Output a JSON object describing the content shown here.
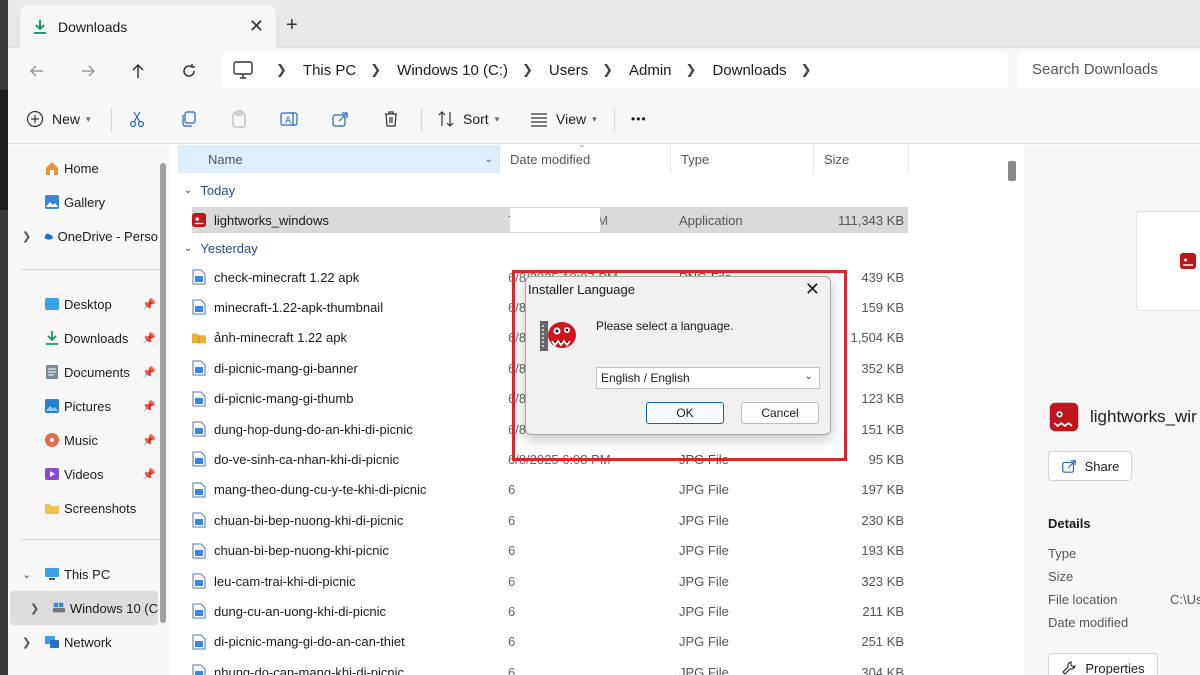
{
  "tab": {
    "title": "Downloads",
    "close": "✕",
    "new": "+"
  },
  "breadcrumbs": [
    "This PC",
    "Windows 10 (C:)",
    "Users",
    "Admin",
    "Downloads"
  ],
  "search": {
    "placeholder": "Search Downloads"
  },
  "toolbar": {
    "new": "New",
    "sort": "Sort",
    "view": "View",
    "more": "•••"
  },
  "sidebar": {
    "home": "Home",
    "gallery": "Gallery",
    "onedrive": "OneDrive - Perso",
    "desktop": "Desktop",
    "downloads": "Downloads",
    "documents": "Documents",
    "pictures": "Pictures",
    "music": "Music",
    "videos": "Videos",
    "screenshots": "Screenshots",
    "thispc": "This PC",
    "windows": "Windows 10 (C",
    "network": "Network"
  },
  "columns": {
    "name": "Name",
    "date": "Date modified",
    "type": "Type",
    "size": "Size"
  },
  "groups": {
    "today": "Today",
    "yesterday": "Yesterday"
  },
  "files_today": [
    {
      "name": "lightworks_windows",
      "date": "7",
      "date_tail": "M",
      "type": "Application",
      "size": "111,343 KB"
    }
  ],
  "files_yesterday": [
    {
      "name": "check-minecraft 1.22 apk",
      "date": "6/8/2025 10:07 PM",
      "type": "PNG File",
      "size": "439 KB"
    },
    {
      "name": "minecraft-1.22-apk-thumbnail",
      "date": "6/8",
      "type": "",
      "size": "159 KB"
    },
    {
      "name": "ảnh-minecraft 1.22 apk",
      "date": "6/8",
      "type": "",
      "size": "1,504 KB"
    },
    {
      "name": "di-picnic-mang-gi-banner",
      "date": "6/8",
      "type": "",
      "size": "352 KB"
    },
    {
      "name": "di-picnic-mang-gi-thumb",
      "date": "6/8",
      "type": "",
      "size": "123 KB"
    },
    {
      "name": "dung-hop-dung-do-an-khi-di-picnic",
      "date": "6/8",
      "type": "",
      "size": "151 KB"
    },
    {
      "name": "do-ve-sinh-ca-nhan-khi-di-picnic",
      "date": "6/8/2025 6:08 PM",
      "type": "JPG File",
      "size": "95 KB"
    },
    {
      "name": "mang-theo-dung-cu-y-te-khi-di-picnic",
      "date": "6",
      "type": "JPG File",
      "size": "197 KB"
    },
    {
      "name": "chuan-bi-bep-nuong-khi-di-picnic",
      "date": "6",
      "type": "JPG File",
      "size": "230 KB"
    },
    {
      "name": "chuan-bi-bep-nuong-khi-picnic",
      "date": "6",
      "type": "JPG File",
      "size": "193 KB"
    },
    {
      "name": "leu-cam-trai-khi-di-picnic",
      "date": "6",
      "type": "JPG File",
      "size": "323 KB"
    },
    {
      "name": "dung-cu-an-uong-khi-di-picnic",
      "date": "6",
      "type": "JPG File",
      "size": "211 KB"
    },
    {
      "name": "di-picnic-mang-gi-do-an-can-thiet",
      "date": "6",
      "type": "JPG File",
      "size": "251 KB"
    },
    {
      "name": "nhung-do-can-mang-khi-di-picnic",
      "date": "6",
      "type": "JPG File",
      "size": "304 KB"
    }
  ],
  "pane": {
    "name": "lightworks_wir",
    "share": "Share",
    "details": "Details",
    "type": "Type",
    "size": "Size",
    "location": "File location",
    "location_value": "C:\\Us",
    "modified": "Date modified",
    "properties": "Properties"
  },
  "dialog": {
    "title": "Installer Language",
    "close": "✕",
    "message": "Please select a language.",
    "selected": "English / English",
    "ok": "OK",
    "cancel": "Cancel"
  },
  "colors": {
    "highlight": "#e0242b",
    "accent": "#0a64c8"
  }
}
